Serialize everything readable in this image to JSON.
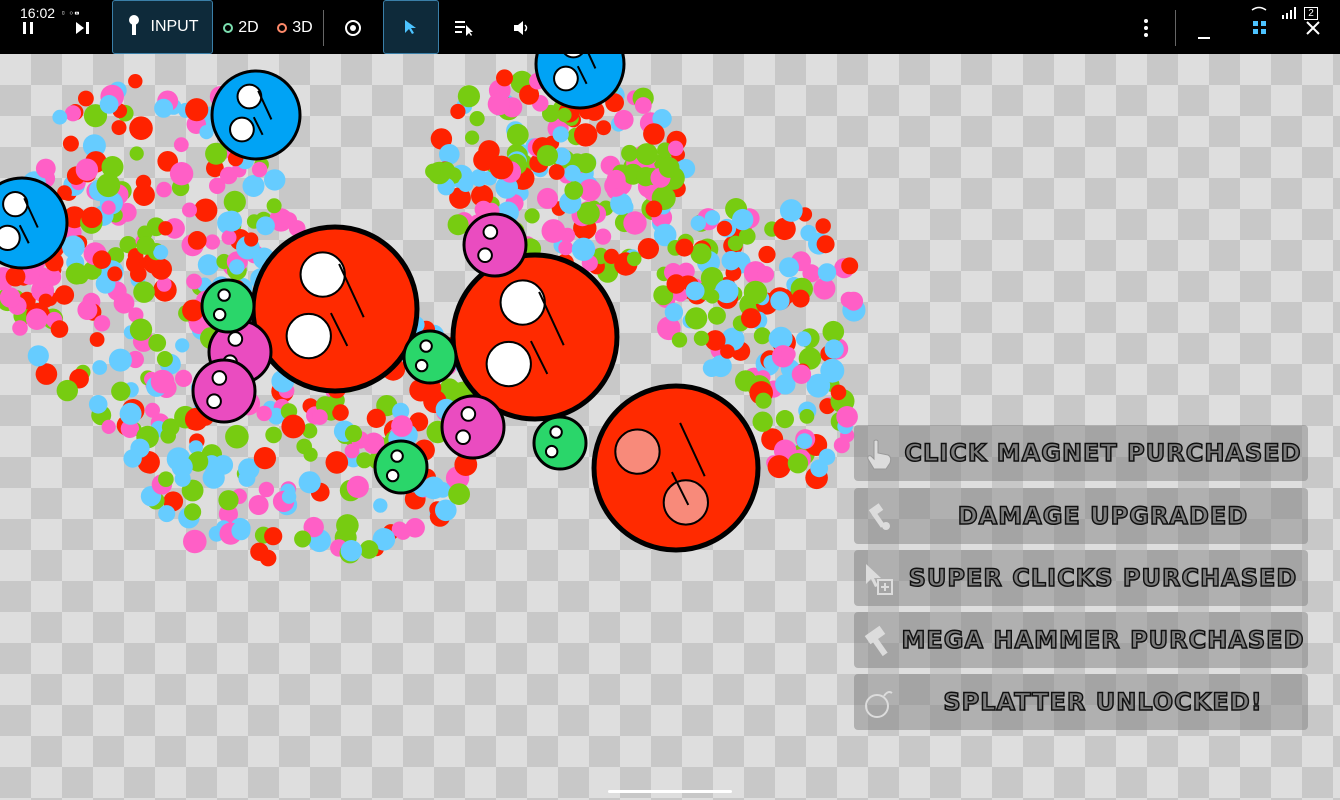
{
  "status_bar": {
    "time": "16:02",
    "battery": "2"
  },
  "toolbar": {
    "input_label": "INPUT",
    "mode_2d_label": "2D",
    "mode_3d_label": "3D",
    "icons": [
      "pause-icon",
      "step-forward-icon",
      "touch-icon",
      "eye-icon",
      "cursor-icon",
      "list-cursor-icon",
      "volume-icon",
      "more-icon",
      "minimize-icon",
      "collapse-icon",
      "close-icon"
    ]
  },
  "notifications": [
    {
      "icon": "hand-pointer-icon",
      "text": "Click Magnet Purchased"
    },
    {
      "icon": "hammer-small-icon",
      "text": "Damage Upgraded"
    },
    {
      "icon": "cursor-plus-icon",
      "text": "Super Clicks Purchased"
    },
    {
      "icon": "hammer-icon",
      "text": "Mega Hammer Purchased"
    },
    {
      "icon": "bomb-icon",
      "text": "Splatter Unlocked!"
    }
  ],
  "colors": {
    "red_ball": "#ff2a00",
    "blue_ball": "#00a3f5",
    "pink_ball": "#ea4cc0",
    "green_ball": "#2ad66a",
    "splat_pink": "#ff5fc6",
    "splat_green": "#77cc11",
    "splat_blue": "#66ccff",
    "splat_red": "#ff2200",
    "toolbar_accent": "#3a7fa8"
  }
}
